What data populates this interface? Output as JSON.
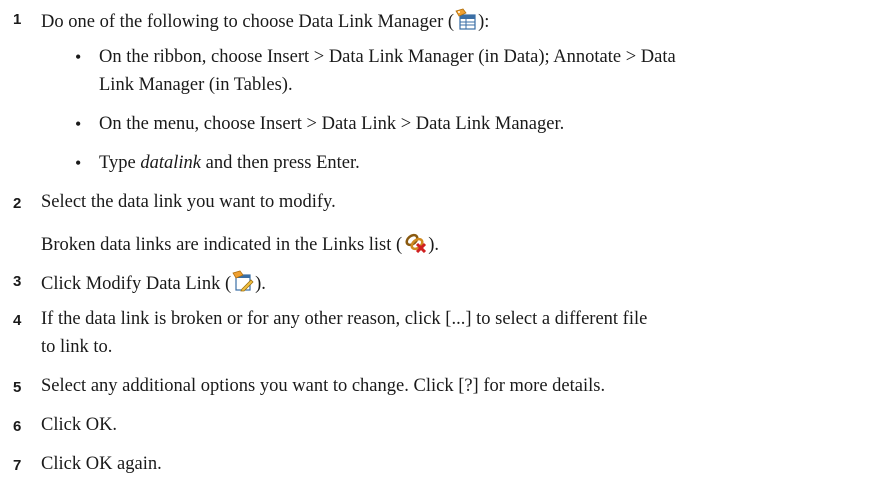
{
  "steps": [
    {
      "num": "1",
      "before": "Do one of the following to choose Data Link Manager (",
      "icon": "data-link-manager-icon",
      "after": "):"
    },
    {
      "num": "2",
      "text": "Select the data link you want to modify.",
      "note_before": "Broken data links are indicated in the Links list (",
      "note_icon": "broken-link-icon",
      "note_after": ")."
    },
    {
      "num": "3",
      "before": "Click Modify Data Link (",
      "icon": "modify-data-link-icon",
      "after": ")."
    },
    {
      "num": "4",
      "text_line1": "If the data link is broken or for any other reason, click [...] to select a different file",
      "text_line2": "to link to."
    },
    {
      "num": "5",
      "text": "Select any additional options you want to change. Click [?] for more details."
    },
    {
      "num": "6",
      "text": "Click OK."
    },
    {
      "num": "7",
      "text": "Click OK again."
    }
  ],
  "sub_bullets": [
    {
      "bullet": "•",
      "line1": "On the ribbon, choose Insert > Data Link Manager (in Data); Annotate > Data",
      "line2": "Link Manager (in Tables)."
    },
    {
      "bullet": "•",
      "line1": "On the menu, choose Insert > Data Link > Data Link Manager."
    },
    {
      "bullet": "•",
      "prefix": "Type ",
      "italic": "datalink",
      "suffix": " and then press Enter."
    }
  ],
  "colors": {
    "text": "#1a1a1a",
    "icon_orange": "#f0a030",
    "icon_blue": "#3a6ea5",
    "icon_red": "#d02020"
  }
}
